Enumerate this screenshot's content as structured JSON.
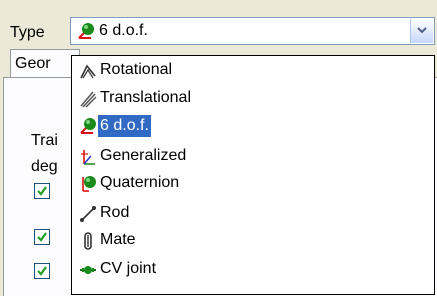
{
  "type_label": "Type",
  "combo": {
    "value": "6 d.o.f.",
    "icon": "ball-joint-icon"
  },
  "tab": {
    "label": "Geor"
  },
  "background_text": [
    "Trai",
    "deg"
  ],
  "checkboxes": [
    true,
    true,
    true
  ],
  "menu_items": [
    {
      "label": "Rotational",
      "icon": "rotational-joint-icon"
    },
    {
      "label": "Translational",
      "icon": "translational-joint-icon"
    },
    {
      "label": "6 d.o.f.",
      "icon": "ball-joint-icon",
      "selected": true
    },
    {
      "label": "Generalized",
      "icon": "generalized-joint-icon"
    },
    {
      "label": "Quaternion",
      "icon": "quaternion-joint-icon"
    },
    {
      "label": "Rod",
      "icon": "rod-joint-icon"
    },
    {
      "label": "Mate",
      "icon": "mate-joint-icon"
    },
    {
      "label": "CV joint",
      "icon": "cv-joint-icon"
    }
  ],
  "colors": {
    "selection": "#316ac5",
    "checkbox_check": "#21a121",
    "ball": "#1a8a1a"
  }
}
